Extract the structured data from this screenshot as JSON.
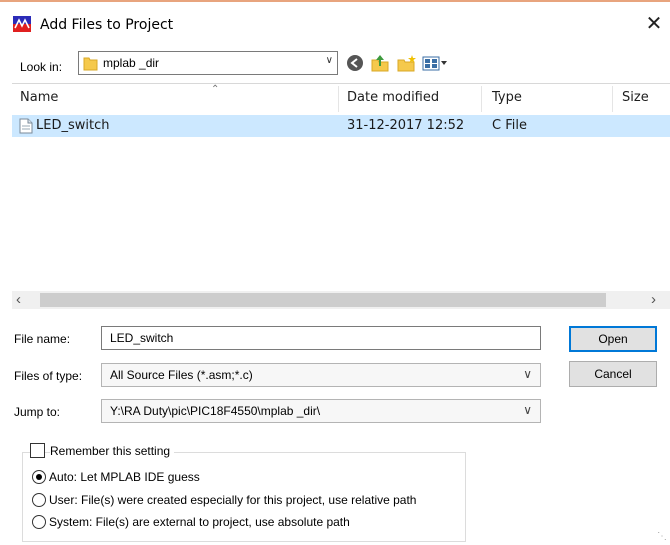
{
  "dialog": {
    "title": "Add Files to Project",
    "close_glyph": "✕"
  },
  "look_in": {
    "label": "Look in:",
    "folder": "mplab _dir"
  },
  "nav_icons": [
    "back-icon",
    "up-folder-icon",
    "new-folder-icon",
    "view-menu-icon"
  ],
  "file_list": {
    "columns": [
      "Name",
      "Date modified",
      "Type",
      "Size"
    ],
    "rows": [
      {
        "name": "LED_switch",
        "date_modified": "31-12-2017 12:52",
        "type": "C File",
        "size": ""
      }
    ]
  },
  "file_name": {
    "label": "File name:",
    "value": "LED_switch"
  },
  "files_of_type": {
    "label": "Files of type:",
    "selected": "All Source Files (*.asm;*.c)"
  },
  "jump_to": {
    "label": "Jump to:",
    "selected": "Y:\\RA Duty\\pic\\PIC18F4550\\mplab _dir\\"
  },
  "buttons": {
    "open": "Open",
    "cancel": "Cancel"
  },
  "options": {
    "remember_label": "Remember this setting",
    "remember_checked": false,
    "radios": [
      {
        "label": "Auto: Let MPLAB IDE guess",
        "selected": true
      },
      {
        "label": "User: File(s) were created especially for this project, use relative path",
        "selected": false
      },
      {
        "label": "System: File(s) are external to project, use absolute path",
        "selected": false
      }
    ]
  },
  "colors": {
    "selection": "#cce8ff",
    "default_button_border": "#0078d7",
    "title_accent": "#e8a47e"
  }
}
